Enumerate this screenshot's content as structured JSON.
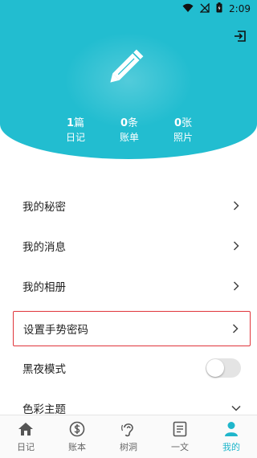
{
  "status": {
    "time": "2:09"
  },
  "profile": {
    "stats": [
      {
        "num": "1",
        "unit": "篇",
        "label": "日记"
      },
      {
        "num": "0",
        "unit": "条",
        "label": "账单"
      },
      {
        "num": "0",
        "unit": "张",
        "label": "照片"
      }
    ]
  },
  "menu": [
    {
      "label": "我的秘密"
    },
    {
      "label": "我的消息"
    },
    {
      "label": "我的相册"
    },
    {
      "label": "设置手势密码",
      "highlight": true
    },
    {
      "label": "黑夜模式",
      "toggle_on": false
    },
    {
      "label": "色彩主题"
    }
  ],
  "tabs": [
    {
      "label": "日记",
      "icon": "home-icon"
    },
    {
      "label": "账本",
      "icon": "dollar-icon"
    },
    {
      "label": "树洞",
      "icon": "ear-icon"
    },
    {
      "label": "一文",
      "icon": "document-icon"
    },
    {
      "label": "我的",
      "icon": "person-icon",
      "active": true
    }
  ],
  "colors": {
    "accent": "#22bdd0",
    "highlight_border": "#e0353b"
  }
}
